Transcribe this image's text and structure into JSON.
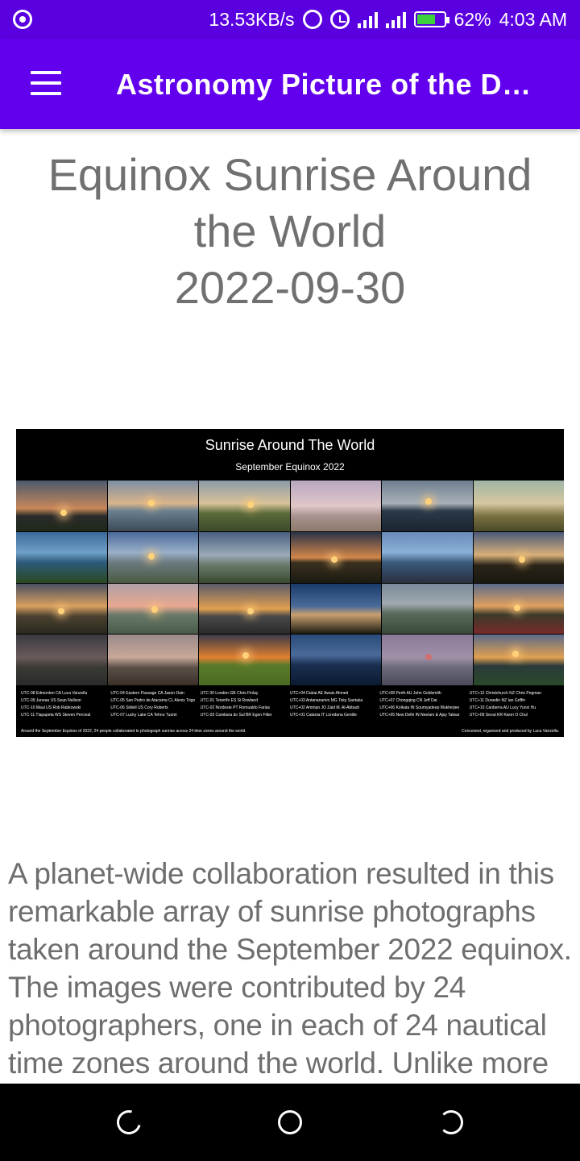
{
  "status_bar": {
    "network_speed": "13.53KB/s",
    "battery_percent": "62%",
    "time": "4:03 AM",
    "icons": [
      "record-icon",
      "hotspot-icon",
      "alarm-icon",
      "signal-icon",
      "signal-icon",
      "battery-charging-icon"
    ]
  },
  "app_bar": {
    "title": "Astronomy Picture of the Day",
    "menu_icon": "hamburger-menu-icon"
  },
  "apod": {
    "title_line1": "Equinox Sunrise Around",
    "title_line2": "the World",
    "date": "2022-09-30",
    "image": {
      "title": "Sunrise Around The World",
      "subtitle": "September Equinox 2022",
      "credits": [
        [
          "UTC-08  Edmonton CA   Luca Vanzella",
          "UTC-09  Juneau US   Sean Neilson",
          "UTC-10  Maui US   Rob Rabkowski",
          "UTC-11  Tlapapeta WS   Steven Percival"
        ],
        [
          "UTC-04  Eastern Passage CA   Jason Dain",
          "UTC-05  San Pedro de Atacama CL   Alexis Trigo",
          "UTC-06  Slidell US   Cory Roberts",
          "UTC-07  Lucky Lake CA   Tehno Tuomi"
        ],
        [
          "UTC 00  London GB   Chris Finlay",
          "UTC-01  Tenerife ES   Si Rowland",
          "UTC-02  Nordeste PT   Romualdo Farias",
          "UTC-03  Cambara do Sul BR   Egon Filter"
        ],
        [
          "UTC+04  Dubai AE   Awais Ahmed",
          "UTC+03  Antananarivo MG   Toky Santaka",
          "UTC+02  Amman JO   Zaid M. Al-Abbadi",
          "UTC+01  Catania IT   Loredana Gentile"
        ],
        [
          "UTC+08  Perth AU   John Goldsmith",
          "UTC+07  Chongqing CN   Jeff Dai",
          "UTC+06  Kolkata IN   Soumyadeep Mukherjee",
          "UTC+05  New Delhi IN   Neelam & Ajay Talwar"
        ],
        [
          "UTC+12  Christchurch NZ   Chris Pegman",
          "UTC+11  Dunedin NZ   Ian Griffin",
          "UTC+10  Canberra AU   Lucy Yunxi Hu",
          "UTC+09  Seoul KR   Kwon O Chul"
        ]
      ],
      "footnote": "Around the September Equinox of 2022, 24 people collaborated to photograph sunrise across 24 time zones around the world.",
      "footnote_right": "Conceived, organized and produced by Luca Vanzella."
    },
    "explanation": "A planet-wide collaboration resulted in this remarkable array of sunrise photographs taken around the September 2022 equinox. The images were contributed by 24 photographers, one in each of 24 nautical time zones around the world. Unlike more"
  },
  "nav_bar": {
    "icons": [
      "recents-icon",
      "home-icon",
      "back-icon"
    ]
  }
}
